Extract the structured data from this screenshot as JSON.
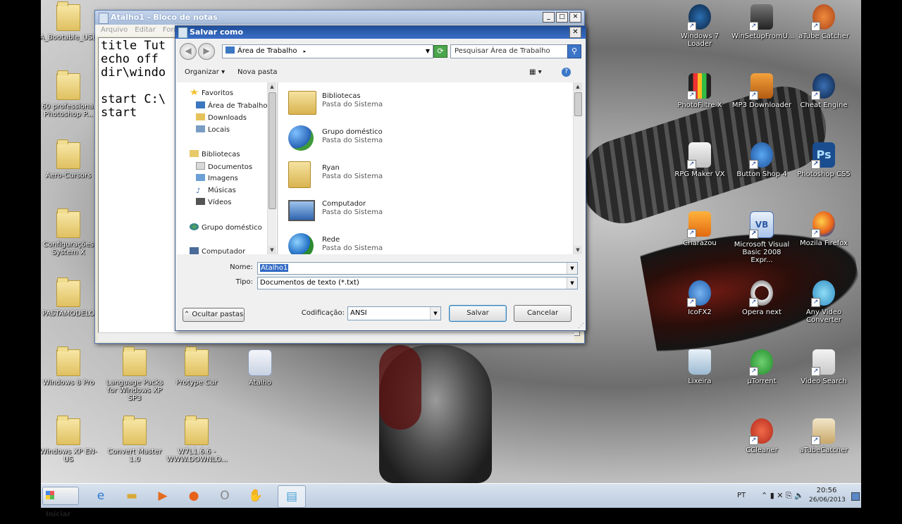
{
  "desktop": {
    "icons": [
      {
        "label": "A_Bootable_USB",
        "type": "folder"
      },
      {
        "label": "60 professional Photoshop P...",
        "type": "folder"
      },
      {
        "label": "Aero-Cursors",
        "type": "folder"
      },
      {
        "label": "Configurações System X",
        "type": "folder"
      },
      {
        "label": "PASTAMODELO",
        "type": "folder"
      },
      {
        "label": "Windows 8 Pro",
        "type": "folder"
      },
      {
        "label": "Language Packs for Windows XP SP3",
        "type": "folder"
      },
      {
        "label": "Protype Cur",
        "type": "folder"
      },
      {
        "label": "Atalho",
        "type": "file"
      },
      {
        "label": "Windows XP EN-US",
        "type": "folder"
      },
      {
        "label": "Convert Master 1.0",
        "type": "folder"
      },
      {
        "label": "W7L1.6.6 - WWW.DOWNLO...",
        "type": "folder"
      },
      {
        "label": "Windows 7 Loader",
        "type": "app"
      },
      {
        "label": "WinSetupFromU...",
        "type": "app"
      },
      {
        "label": "aTube Catcher",
        "type": "app"
      },
      {
        "label": "PhotoFiltre X",
        "type": "app"
      },
      {
        "label": "MP3 Downloader",
        "type": "app"
      },
      {
        "label": "Cheat Engine",
        "type": "app"
      },
      {
        "label": "RPG Maker VX",
        "type": "app"
      },
      {
        "label": "Button Shop 4",
        "type": "app"
      },
      {
        "label": "Photoshop CS5",
        "type": "app"
      },
      {
        "label": "Charazou",
        "type": "app"
      },
      {
        "label": "Microsoft Visual Basic 2008 Expr...",
        "type": "app"
      },
      {
        "label": "Mozila Firefox",
        "type": "app"
      },
      {
        "label": "IcoFX2",
        "type": "app"
      },
      {
        "label": "Opera next",
        "type": "app"
      },
      {
        "label": "Any Video Converter",
        "type": "app"
      },
      {
        "label": "Lixeira",
        "type": "app"
      },
      {
        "label": "µTorrent",
        "type": "app"
      },
      {
        "label": "Video Search",
        "type": "app"
      },
      {
        "label": "CCleaner",
        "type": "app"
      },
      {
        "label": "aTubeCatcher",
        "type": "app"
      }
    ]
  },
  "notepad": {
    "title": "Atalho1 - Bloco de notas",
    "menu": [
      "Arquivo",
      "Editar",
      "Forma"
    ],
    "content": "title Tut\necho off\ndir\\windo\n\nstart C:\\\nstart"
  },
  "save_dialog": {
    "title": "Salvar como",
    "address": "Área de Trabalho",
    "search_placeholder": "Pesquisar Área de Trabalho",
    "organize_label": "Organizar",
    "new_folder_label": "Nova pasta",
    "nav": [
      {
        "label": "Favoritos",
        "icon": "star-icon",
        "indent": 0
      },
      {
        "label": "Área de Trabalho",
        "icon": "desktop-icon",
        "indent": 1
      },
      {
        "label": "Downloads",
        "icon": "downloads-icon",
        "indent": 1
      },
      {
        "label": "Locais",
        "icon": "places-icon",
        "indent": 1
      },
      {
        "label": "Bibliotecas",
        "icon": "libraries-icon",
        "indent": 0
      },
      {
        "label": "Documentos",
        "icon": "documents-icon",
        "indent": 1
      },
      {
        "label": "Imagens",
        "icon": "images-icon",
        "indent": 1
      },
      {
        "label": "Músicas",
        "icon": "music-icon",
        "indent": 1
      },
      {
        "label": "Vídeos",
        "icon": "videos-icon",
        "indent": 1
      },
      {
        "label": "Grupo doméstico",
        "icon": "homegroup-icon",
        "indent": 0
      },
      {
        "label": "Computador",
        "icon": "computer-icon",
        "indent": 0
      }
    ],
    "items": [
      {
        "name": "Bibliotecas",
        "type": "Pasta do Sistema",
        "icon": "libraries-icon"
      },
      {
        "name": "Grupo doméstico",
        "type": "Pasta do Sistema",
        "icon": "homegroup-icon"
      },
      {
        "name": "Ryan",
        "type": "Pasta do Sistema",
        "icon": "user-folder-icon"
      },
      {
        "name": "Computador",
        "type": "Pasta do Sistema",
        "icon": "computer-icon"
      },
      {
        "name": "Rede",
        "type": "Pasta do Sistema",
        "icon": "network-icon"
      }
    ],
    "name_label": "Nome:",
    "name_value": "Atalho1",
    "type_label": "Tipo:",
    "type_value": "Documentos de texto (*.txt)",
    "hide_folders_label": "Ocultar pastas",
    "encoding_label": "Codificação:",
    "encoding_value": "ANSI",
    "save_label": "Salvar",
    "cancel_label": "Cancelar"
  },
  "taskbar": {
    "start_label": "Iniciar",
    "apps": [
      "internet-explorer-icon",
      "explorer-icon",
      "media-player-icon",
      "firefox-icon",
      "opera-icon",
      "atube-icon",
      "notepad-icon"
    ],
    "language": "PT",
    "time": "20:56",
    "date": "26/06/2013"
  }
}
